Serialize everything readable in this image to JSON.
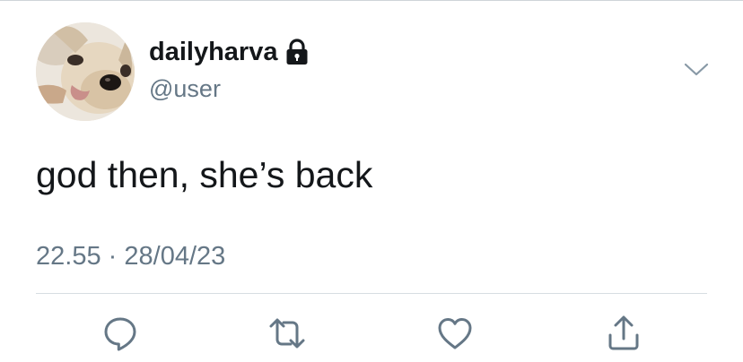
{
  "tweet": {
    "display_name": "dailyharva",
    "handle": "@user",
    "text": "god then, she’s back",
    "time": "22.55",
    "separator": "·",
    "date": "28/04/23",
    "account_protected": true
  },
  "icons": {
    "lock": "lock-icon",
    "menu": "chevron-down-icon",
    "reply": "reply-icon",
    "retweet": "retweet-icon",
    "like": "heart-icon",
    "share": "share-icon"
  },
  "colors": {
    "text_primary": "#14171a",
    "text_secondary": "#657786",
    "divider": "#d7dde2",
    "icon": "#657786"
  }
}
